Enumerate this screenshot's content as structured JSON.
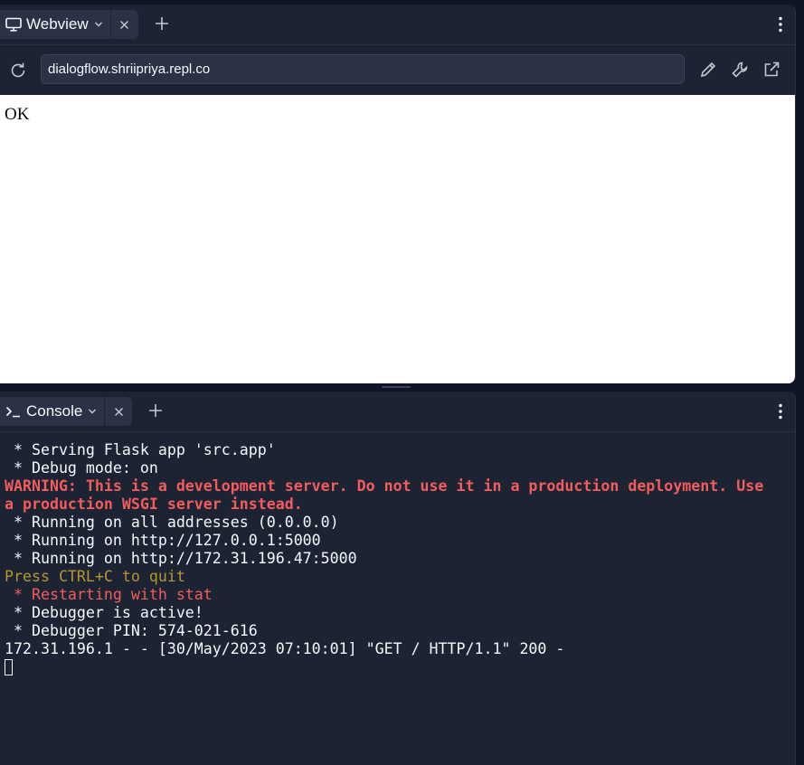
{
  "webview": {
    "tab_label": "Webview",
    "url": "dialogflow.shriipriya.repl.co",
    "page_text": "OK"
  },
  "console": {
    "tab_label": "Console",
    "lines": [
      " * Serving Flask app 'src.app'",
      " * Debug mode: on",
      "WARNING: This is a development server. Do not use it in a production deployment. Use",
      "a production WSGI server instead.",
      " * Running on all addresses (0.0.0.0)",
      " * Running on http://127.0.0.1:5000",
      " * Running on http://172.31.196.47:5000",
      "Press CTRL+C to quit",
      " * Restarting with stat",
      " * Debugger is active!",
      " * Debugger PIN: 574-021-616",
      "172.31.196.1 - - [30/May/2023 07:10:01] \"GET / HTTP/1.1\" 200 -"
    ]
  },
  "icons": {
    "webview_tab": "monitor-icon",
    "console_tab": "terminal-prompt-icon",
    "chevron": "chevron-down-icon",
    "close": "close-icon",
    "add": "plus-icon",
    "menu": "kebab-menu-icon",
    "refresh": "refresh-icon",
    "edit": "pencil-icon",
    "devtools": "wrench-icon",
    "open_external": "external-link-icon"
  },
  "colors": {
    "background": "#0e1525",
    "panel": "#1c2333",
    "surface": "#2b3245",
    "text": "#f5f9fc",
    "warning": "#f25c5c",
    "hint": "#b5962f"
  }
}
